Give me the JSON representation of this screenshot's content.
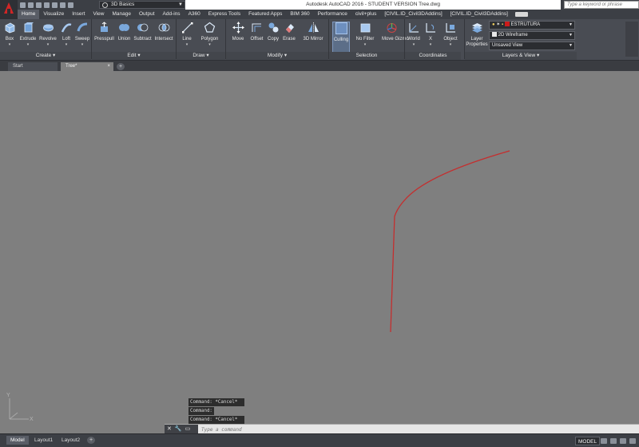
{
  "title_bar": {
    "workspace": "3D Basics",
    "window_title": "Autodesk AutoCAD 2016 - STUDENT VERSION    Tree.dwg",
    "search_placeholder": "Type a keyword or phrase"
  },
  "ribbon_tabs": [
    "Home",
    "Visualize",
    "Insert",
    "View",
    "Manage",
    "Output",
    "Add-ins",
    "A360",
    "Express Tools",
    "Featured Apps",
    "BIM 360",
    "Performance",
    "civil+plus",
    "[CIVIL.ID_Civil3DAddins]",
    "[CIVIL.ID_Civil3DAddins]"
  ],
  "ribbon": {
    "create": {
      "label": "Create",
      "tools": [
        "Box",
        "Extrude",
        "Revolve",
        "Loft",
        "Sweep"
      ]
    },
    "edit": {
      "label": "Edit",
      "tools": [
        "Presspull",
        "Union",
        "Subtract",
        "Intersect"
      ]
    },
    "draw": {
      "label": "Draw",
      "tools": [
        "Line",
        "Polygon"
      ]
    },
    "modify": {
      "label": "Modify",
      "tools": [
        "Move",
        "Offset",
        "Copy",
        "Erase",
        "3D Mirror"
      ]
    },
    "selection": {
      "label": "Selection",
      "tools": [
        "Culling",
        "No Filter",
        "Move Gizmo"
      ]
    },
    "coordinates": {
      "label": "Coordinates",
      "tools": [
        "World",
        "X",
        "Object"
      ]
    },
    "layers_view": {
      "label": "Layers & View",
      "layer_properties": "Layer Properties",
      "current_layer": "ESTRUTURA",
      "visual_style": "2D Wireframe",
      "named_view": "Unsaved View",
      "layer_color": "#cc1b1b"
    }
  },
  "file_tabs": [
    "Start",
    "Tree*"
  ],
  "command_history": [
    "Command: *Cancel*",
    "Command:",
    "Command: *Cancel*"
  ],
  "command_placeholder": "Type a command",
  "layout_tabs": [
    "Model",
    "Layout1",
    "Layout2"
  ],
  "status": {
    "space": "MODEL"
  },
  "ucs": {
    "x": "X",
    "y": "Y"
  },
  "drawing": {
    "stroke_color": "#c42f2f"
  }
}
